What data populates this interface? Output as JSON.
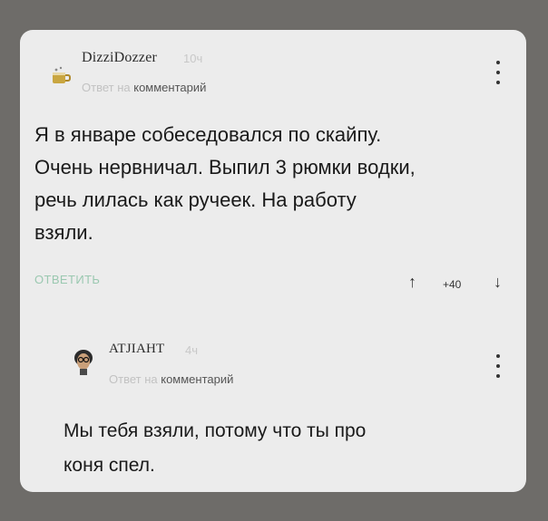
{
  "comment": {
    "username": "DizziDozzer",
    "time": "10ч",
    "reply_prefix": "Ответ на",
    "reply_target": "комментарий",
    "text_lines": [
      "Я в январе собеседовался по скайпу.",
      "Очень нервничал. Выпил 3 рюмки водки,",
      "речь лилась как ручеек. На работу",
      "взяли."
    ],
    "reply_label": "ОТВЕТИТЬ",
    "up_arrow": "↑",
    "score": "+40",
    "down_arrow": "↓",
    "menu_icon": "kebab-menu-icon",
    "avatar_icon": "avatar-mug-icon"
  },
  "reply": {
    "username": "ATJIAHT",
    "time": "4ч",
    "reply_prefix": "Ответ на",
    "reply_target": "комментарий",
    "text_lines": [
      "Мы тебя взяли, потому что ты про",
      "коня спел."
    ],
    "menu_icon": "kebab-menu-icon",
    "avatar_icon": "avatar-man-glasses-icon"
  },
  "colors": {
    "background": "#6e6c69",
    "card": "#ececec",
    "reply_link": "#9ac8b0",
    "muted_text": "#c2c2c2"
  }
}
